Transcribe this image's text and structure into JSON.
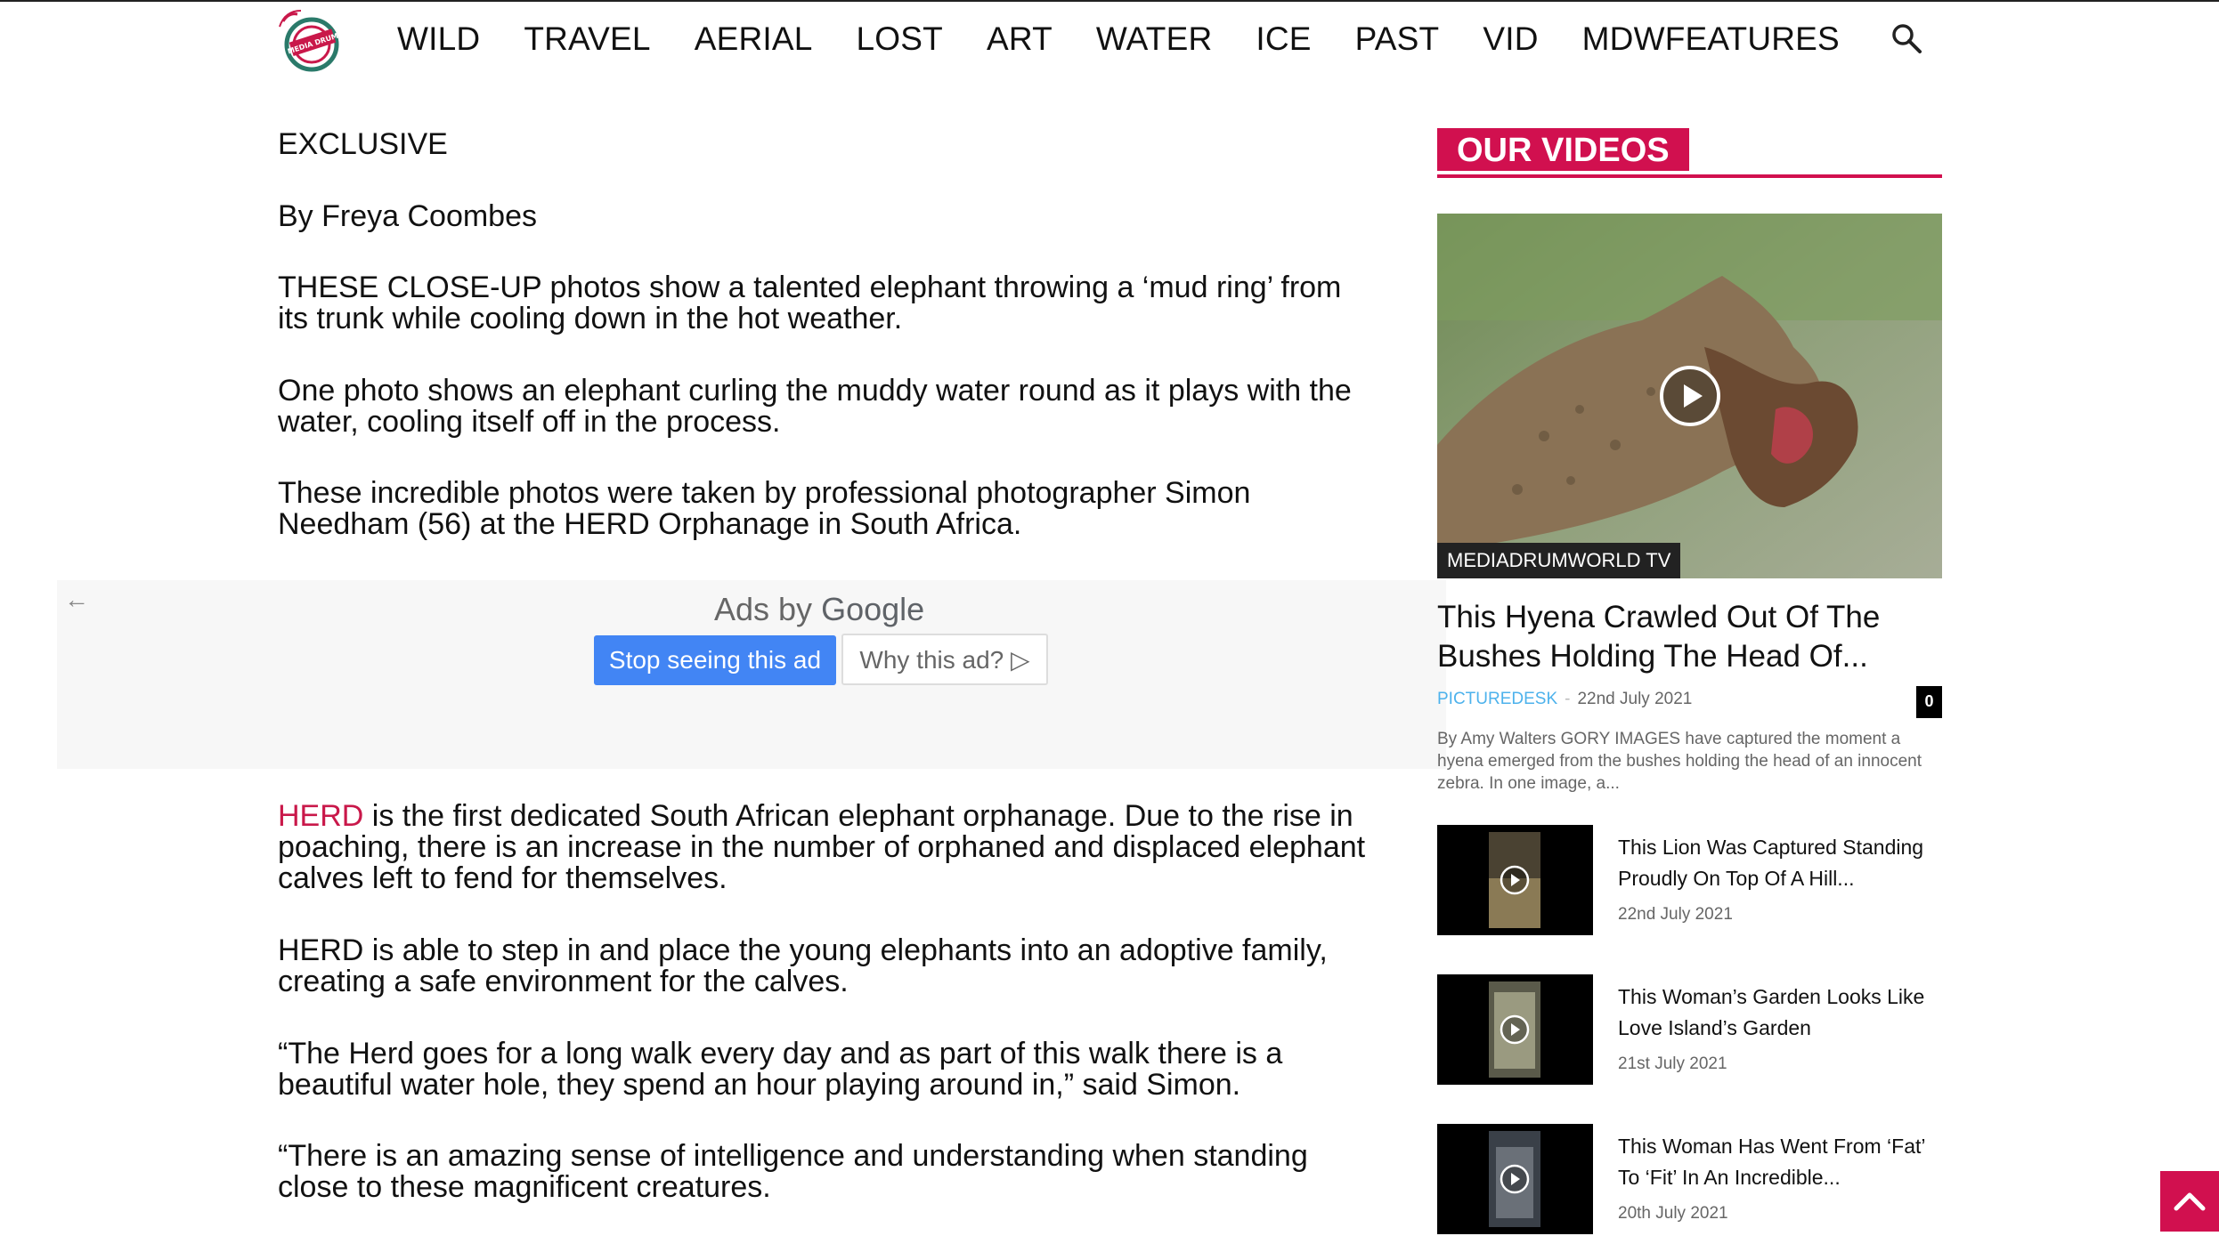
{
  "nav": {
    "logo_alt": "MEDIA DRUM WORLD",
    "items": [
      "WILD",
      "TRAVEL",
      "AERIAL",
      "LOST",
      "ART",
      "WATER",
      "ICE",
      "PAST",
      "VID",
      "MDWFEATURES"
    ]
  },
  "article": {
    "kicker": "EXCLUSIVE",
    "byline": "By Freya Coombes",
    "p1": "THESE CLOSE-UP photos show a talented elephant throwing a ‘mud ring’ from its trunk while cooling down in the hot weather.",
    "p2": "One photo shows an elephant curling the muddy water round as it plays with the water, cooling itself off in the process.",
    "p3": "These incredible photos were taken by professional photographer Simon Needham (56) at the HERD Orphanage in South Africa.",
    "p4_link": "HERD",
    "p4_rest": " is the first dedicated South African elephant orphanage. Due to the rise in poaching, there is an increase in the number of orphaned and displaced elephant calves left to fend for themselves.",
    "p5": "HERD is able to step in and place the young elephants into an adoptive family, creating a safe environment for the calves.",
    "p6": "“The Herd goes for a long walk every day and as part of this walk there is a beautiful water hole, they spend an hour playing around in,” said Simon.",
    "p7": "“There is an amazing sense of intelligence and understanding when standing close to these magnificent creatures."
  },
  "ad": {
    "ads_by": "Ads by",
    "google": "Google",
    "stop_label": "Stop seeing this ad",
    "why_label": "Why this ad?"
  },
  "sidebar": {
    "title": "OUR VIDEOS",
    "featured": {
      "category": "MEDIADRUMWORLD TV",
      "title": "This Hyena Crawled Out Of The Bushes Holding The Head Of...",
      "author": "PICTUREDESK",
      "date": "22nd July 2021",
      "comments": "0",
      "excerpt": "By Amy Walters   GORY IMAGES have captured the moment a hyena emerged from the bushes holding the head of an innocent zebra. In one image, a..."
    },
    "videos": [
      {
        "title": "This Lion Was Captured Standing Proudly On Top Of A Hill...",
        "date": "22nd July 2021"
      },
      {
        "title": "This Woman’s Garden Looks Like Love Island’s Garden",
        "date": "21st July 2021"
      },
      {
        "title": "This Woman Has Went From ‘Fat’ To ‘Fit’ In An Incredible...",
        "date": "20th July 2021"
      }
    ]
  },
  "colors": {
    "accent": "#d1104f",
    "link_red": "#c9184a",
    "author_blue": "#4db2ec",
    "ad_blue": "#4285f4"
  }
}
